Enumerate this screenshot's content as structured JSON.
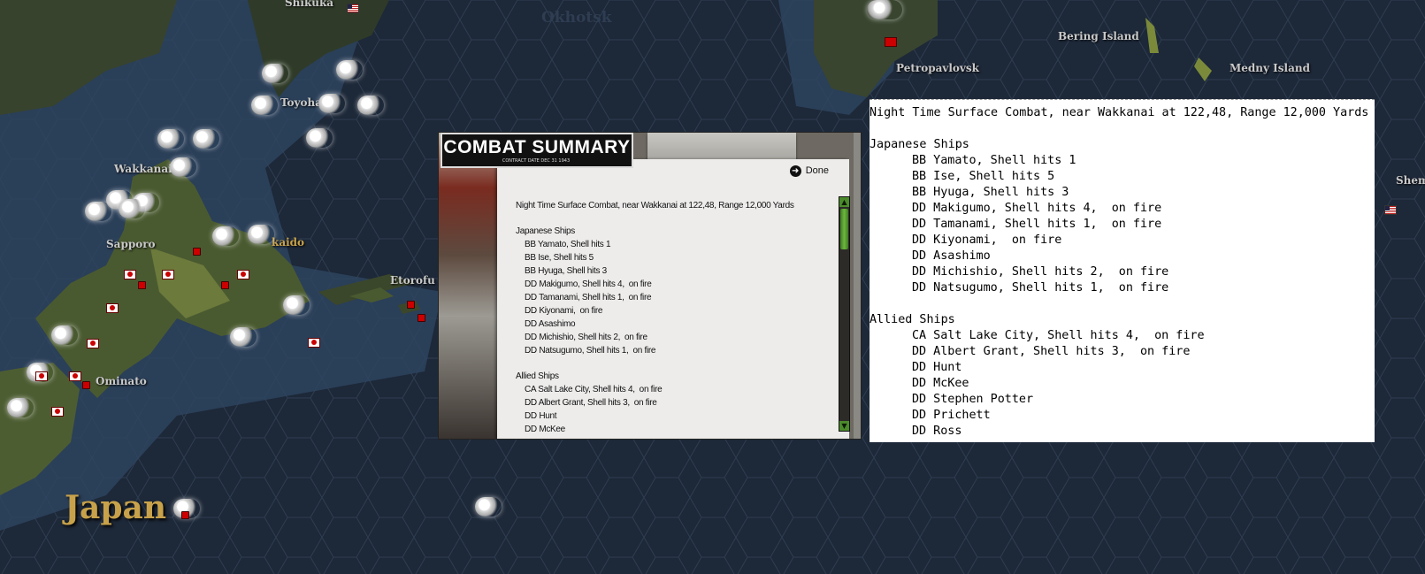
{
  "map": {
    "labels": {
      "shikuka": "Shikuka",
      "okhotsk": "Okhotsk",
      "bering_island": "Bering Island",
      "medny_island": "Medny Island",
      "petropavlovsk": "Petropavlovsk",
      "toyohara": "Toyohara",
      "wakkanai": "Wakkanai",
      "sapporo": "Sapporo",
      "kushiro": "kaido",
      "etorofu": "Etorofu",
      "ominato": "Ominato",
      "japan": "Japan",
      "shem": "Shem"
    }
  },
  "combat_summary": {
    "title": "COMBAT SUMMARY",
    "subtitle": "CONTRACT DATE DEC 31 1943",
    "done_label": "Done",
    "header": "Night Time Surface Combat, near Wakkanai at 122,48, Range 12,000 Yards",
    "japanese_heading": "Japanese Ships",
    "japanese_ships": [
      "BB Yamato, Shell hits 1",
      "BB Ise, Shell hits 5",
      "BB Hyuga, Shell hits 3",
      "DD Makigumo, Shell hits 4,  on fire",
      "DD Tamanami, Shell hits 1,  on fire",
      "DD Kiyonami,  on fire",
      "DD Asashimo",
      "DD Michishio, Shell hits 2,  on fire",
      "DD Natsugumo, Shell hits 1,  on fire"
    ],
    "allied_heading": "Allied Ships",
    "allied_ships_visible": [
      "CA Salt Lake City, Shell hits 4,  on fire",
      "DD Albert Grant, Shell hits 3,  on fire",
      "DD Hunt",
      "DD McKee"
    ]
  },
  "log": {
    "header": "Night Time Surface Combat, near Wakkanai at 122,48, Range 12,000 Yards",
    "japanese_heading": "Japanese Ships",
    "japanese_ships": [
      "BB Yamato, Shell hits 1",
      "BB Ise, Shell hits 5",
      "BB Hyuga, Shell hits 3",
      "DD Makigumo, Shell hits 4,  on fire",
      "DD Tamanami, Shell hits 1,  on fire",
      "DD Kiyonami,  on fire",
      "DD Asashimo",
      "DD Michishio, Shell hits 2,  on fire",
      "DD Natsugumo, Shell hits 1,  on fire"
    ],
    "allied_heading": "Allied Ships",
    "allied_ships": [
      "CA Salt Lake City, Shell hits 4,  on fire",
      "DD Albert Grant, Shell hits 3,  on fire",
      "DD Hunt",
      "DD McKee",
      "DD Stephen Potter",
      "DD Prichett",
      "DD Ross"
    ]
  }
}
